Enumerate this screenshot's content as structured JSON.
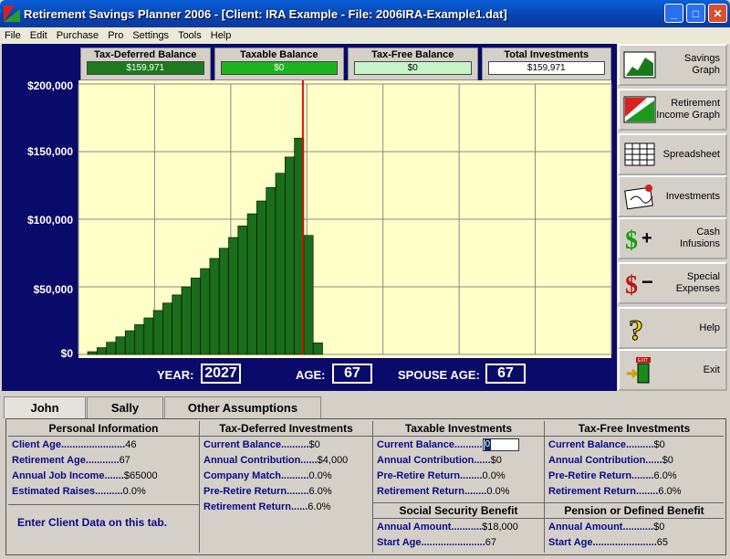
{
  "window": {
    "title": "Retirement Savings Planner 2006 - [Client: IRA Example  - File: 2006IRA-Example1.dat]",
    "min_glyph": "_",
    "max_glyph": "□",
    "close_glyph": "✕"
  },
  "menu": [
    "File",
    "Edit",
    "Purchase",
    "Pro",
    "Settings",
    "Tools",
    "Help"
  ],
  "balances": [
    {
      "label": "Tax-Deferred Balance",
      "value": "$159,971",
      "color": "#1e7a1e"
    },
    {
      "label": "Taxable Balance",
      "value": "$0",
      "color": "#1cb41c"
    },
    {
      "label": "Tax-Free Balance",
      "value": "$0",
      "color": "#c8f5c8"
    },
    {
      "label": "Total Investments",
      "value": "$159,971",
      "color": "#ffffff"
    }
  ],
  "chart_data": {
    "type": "bar",
    "ylabels": [
      "$200,000",
      "$150,000",
      "$100,000",
      "$50,000",
      "$0"
    ],
    "ylim": [
      0,
      200000
    ],
    "grid": true,
    "bar_color": "#1a6e1a",
    "background": "#ffffc8",
    "values": [
      2000,
      5000,
      9000,
      13000,
      17500,
      22000,
      27000,
      32500,
      38000,
      44000,
      50000,
      56500,
      63500,
      71000,
      78500,
      86500,
      95000,
      104000,
      113500,
      123500,
      134000,
      146000,
      160000,
      88000,
      8500
    ],
    "marker_index": 22,
    "marker_color": "#d81010"
  },
  "status": {
    "year_label": "YEAR:",
    "year": "2027",
    "age_label": "AGE:",
    "age": "67",
    "spouse_label": "SPOUSE AGE:",
    "spouse_age": "67"
  },
  "side_buttons": [
    {
      "label": "Savings\nGraph",
      "icon": "savings-graph-icon"
    },
    {
      "label": "Retirement\nIncome Graph",
      "icon": "income-graph-icon"
    },
    {
      "label": "Spreadsheet",
      "icon": "spreadsheet-icon"
    },
    {
      "label": "Investments",
      "icon": "investments-icon"
    },
    {
      "label": "Cash\nInfusions",
      "icon": "cash-plus-icon"
    },
    {
      "label": "Special\nExpenses",
      "icon": "cash-minus-icon"
    },
    {
      "label": "Help",
      "icon": "help-icon"
    },
    {
      "label": "Exit",
      "icon": "exit-icon"
    }
  ],
  "icon_glyphs": {
    "plus": "+",
    "minus": "−",
    "dollar": "$",
    "question": "?",
    "exit_sign": "EXIT"
  },
  "tabs": [
    "John",
    "Sally",
    "Other Assumptions"
  ],
  "personal": {
    "title": "Personal Information",
    "rows": [
      {
        "k": "Client Age.......................",
        "v": "46"
      },
      {
        "k": "Retirement Age............",
        "v": "67"
      },
      {
        "k": "Annual Job Income.......",
        "v": "$65000"
      },
      {
        "k": "Estimated Raises..........",
        "v": "0.0%"
      }
    ],
    "hint": "Enter Client Data on this tab."
  },
  "tax_deferred": {
    "title": "Tax-Deferred Investments",
    "rows": [
      {
        "k": "Current Balance..........",
        "v": "$0"
      },
      {
        "k": "Annual Contribution......",
        "v": "$4,000"
      },
      {
        "k": "Company Match..........",
        "v": "0.0%"
      },
      {
        "k": "Pre-Retire Return........",
        "v": "6.0%"
      },
      {
        "k": "Retirement Return......",
        "v": "6.0%"
      }
    ]
  },
  "taxable": {
    "title": "Taxable Investments",
    "rows": [
      {
        "k": "Current Balance..........",
        "v": "0"
      },
      {
        "k": "Annual Contribution......",
        "v": "$0"
      },
      {
        "k": "Pre-Retire Return........",
        "v": "0.0%"
      },
      {
        "k": "Retirement Return........",
        "v": "0.0%"
      }
    ]
  },
  "tax_free": {
    "title": "Tax-Free Investments",
    "rows": [
      {
        "k": "Current Balance..........",
        "v": "$0"
      },
      {
        "k": "Annual Contribution......",
        "v": "$0"
      },
      {
        "k": "Pre-Retire Return........",
        "v": "6.0%"
      },
      {
        "k": "Retirement Return........",
        "v": "6.0%"
      }
    ]
  },
  "social_security": {
    "title": "Social Security Benefit",
    "rows": [
      {
        "k": "Annual Amount...........",
        "v": "$18,000"
      },
      {
        "k": "Start Age.......................",
        "v": "67"
      }
    ]
  },
  "pension": {
    "title": "Pension or Defined Benefit",
    "rows": [
      {
        "k": "Annual Amount...........",
        "v": "$0"
      },
      {
        "k": "Start Age.......................",
        "v": "65"
      }
    ]
  }
}
